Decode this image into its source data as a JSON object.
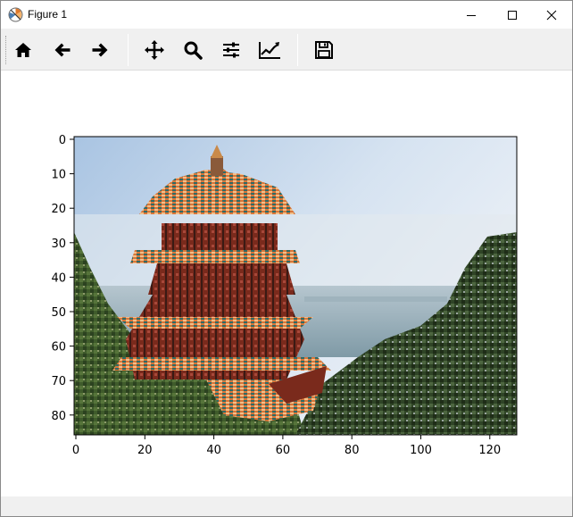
{
  "window": {
    "title": "Figure 1",
    "icon": "matplotlib-icon",
    "controls": [
      "minimize-icon",
      "maximize-icon",
      "close-icon"
    ]
  },
  "toolbar": {
    "tools": [
      {
        "name": "home-icon",
        "tooltip": "Home"
      },
      {
        "name": "back-icon",
        "tooltip": "Back"
      },
      {
        "name": "forward-icon",
        "tooltip": "Forward"
      },
      {
        "name": "pan-icon",
        "tooltip": "Pan"
      },
      {
        "name": "zoom-icon",
        "tooltip": "Zoom"
      },
      {
        "name": "subplots-icon",
        "tooltip": "Subplots"
      },
      {
        "name": "customize-icon",
        "tooltip": "Customize"
      },
      {
        "name": "save-icon",
        "tooltip": "Save"
      }
    ]
  },
  "plot": {
    "type": "image",
    "content": "pixelated photo of a multi-tiered Chinese pagoda with blue sky, lake and green trees",
    "x_range": [
      0,
      128
    ],
    "y_range": [
      86,
      0
    ],
    "x_ticks": [
      "0",
      "20",
      "40",
      "60",
      "80",
      "100",
      "120"
    ],
    "y_ticks": [
      "0",
      "10",
      "20",
      "30",
      "40",
      "50",
      "60",
      "70",
      "80"
    ]
  },
  "colors": {
    "sky": "#c9d9ec",
    "lake": "#8fa9b8",
    "foliage": "#3e5a2a",
    "roof_orange": "#d9763a",
    "timber_red": "#7a2a1c",
    "teal_trim": "#2f6b66"
  }
}
